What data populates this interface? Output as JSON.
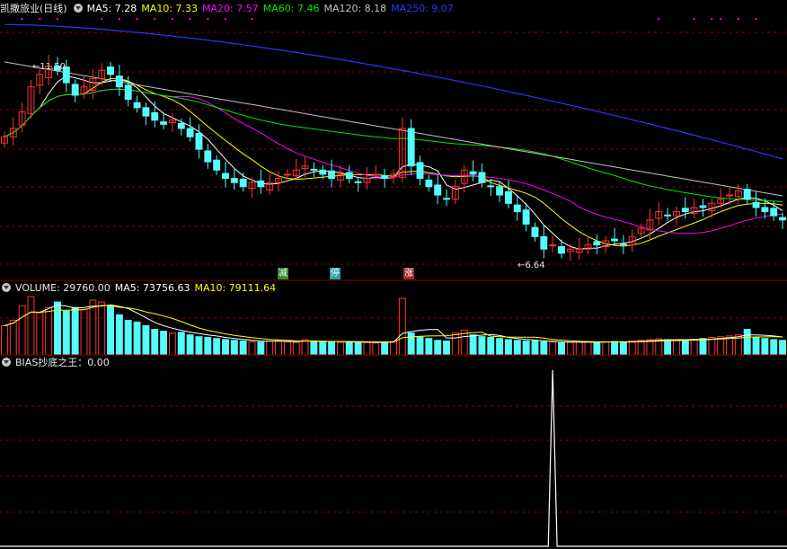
{
  "header_main": {
    "title": "凯撒旅业(日线)",
    "ma5": "MA5: 7.28",
    "ma10": "MA10: 7.33",
    "ma20": "MA20: 7.57",
    "ma60": "MA60: 7.46",
    "ma120": "MA120: 8.18",
    "ma250": "MA250: 9.07"
  },
  "header_volume": {
    "title": "VOLUME: 29760.00",
    "ma5": "MA5: 73756.63",
    "ma10": "MA10: 79111.64"
  },
  "header_indicator": {
    "title": "BIAS抄底之王：0.00"
  },
  "annotations": {
    "high": "11.50",
    "low": "6.64"
  },
  "signals": [
    {
      "label": "减",
      "color": "#2e8b2e"
    },
    {
      "label": "停",
      "color": "#2e9fa8"
    },
    {
      "label": "涨",
      "color": "#a0282d"
    }
  ],
  "colors": {
    "up": "#ff3232",
    "down": "#54fcfc",
    "ma5": "#ffffff",
    "ma10": "#ffff00",
    "ma20": "#ff00ff",
    "ma60": "#00e600",
    "ma120": "#c0c0c0",
    "ma250": "#3232ff",
    "grid": "#8b0000",
    "bias": "#ffffff"
  },
  "chart_data": [
    {
      "type": "candlestick",
      "title": "凯撒旅业(日线)",
      "price_range": [
        6.3,
        12.5
      ],
      "annotated_high": 11.5,
      "annotated_low": 6.64,
      "closes": [
        9.6,
        9.8,
        10.2,
        10.8,
        11.1,
        11.3,
        11.2,
        10.9,
        10.6,
        10.8,
        11.0,
        11.2,
        11.1,
        10.8,
        10.5,
        10.3,
        10.1,
        10.0,
        9.9,
        10.0,
        9.8,
        9.6,
        9.3,
        9.0,
        8.8,
        8.6,
        8.5,
        8.4,
        8.5,
        8.4,
        8.5,
        8.6,
        8.7,
        8.8,
        8.9,
        8.8,
        8.7,
        8.6,
        8.7,
        8.6,
        8.5,
        8.6,
        8.7,
        8.6,
        8.7,
        9.8,
        8.9,
        8.6,
        8.4,
        8.2,
        8.1,
        8.4,
        8.8,
        8.7,
        8.5,
        8.4,
        8.2,
        8.0,
        7.8,
        7.5,
        7.2,
        6.9,
        7.0,
        6.8,
        6.9,
        6.9,
        7.0,
        7.0,
        7.1,
        7.1,
        7.0,
        7.2,
        7.4,
        7.6,
        7.8,
        7.7,
        7.8,
        7.8,
        7.9,
        7.9,
        8.0,
        8.1,
        8.2,
        8.3,
        8.1,
        7.9,
        7.8,
        7.7,
        7.6
      ],
      "ma250_last": 9.07,
      "ma120_last": 8.18,
      "ma60_last": 7.46,
      "ma20_last": 7.57,
      "ma10_last": 7.33,
      "ma5_last": 7.28
    },
    {
      "type": "bar",
      "title": "VOLUME",
      "last_value": 29760.0,
      "ma5_last": 73756.63,
      "ma10_last": 79111.64,
      "values": [
        80,
        95,
        135,
        160,
        115,
        130,
        145,
        120,
        130,
        125,
        150,
        145,
        135,
        110,
        95,
        90,
        80,
        70,
        65,
        60,
        62,
        55,
        50,
        48,
        45,
        42,
        40,
        38,
        36,
        35,
        38,
        40,
        36,
        34,
        42,
        38,
        36,
        35,
        34,
        36,
        35,
        34,
        33,
        35,
        37,
        155,
        60,
        50,
        45,
        40,
        38,
        60,
        68,
        55,
        50,
        48,
        45,
        42,
        40,
        38,
        38,
        36,
        35,
        33,
        34,
        35,
        36,
        35,
        36,
        37,
        36,
        38,
        40,
        42,
        44,
        42,
        41,
        40,
        43,
        45,
        48,
        50,
        52,
        55,
        70,
        48,
        45,
        42,
        40
      ]
    },
    {
      "type": "line",
      "title": "BIAS抄底之王",
      "last_value": 0.0,
      "spike_index": 62,
      "spike_value": 1.0,
      "ylim": [
        0,
        1
      ]
    }
  ]
}
